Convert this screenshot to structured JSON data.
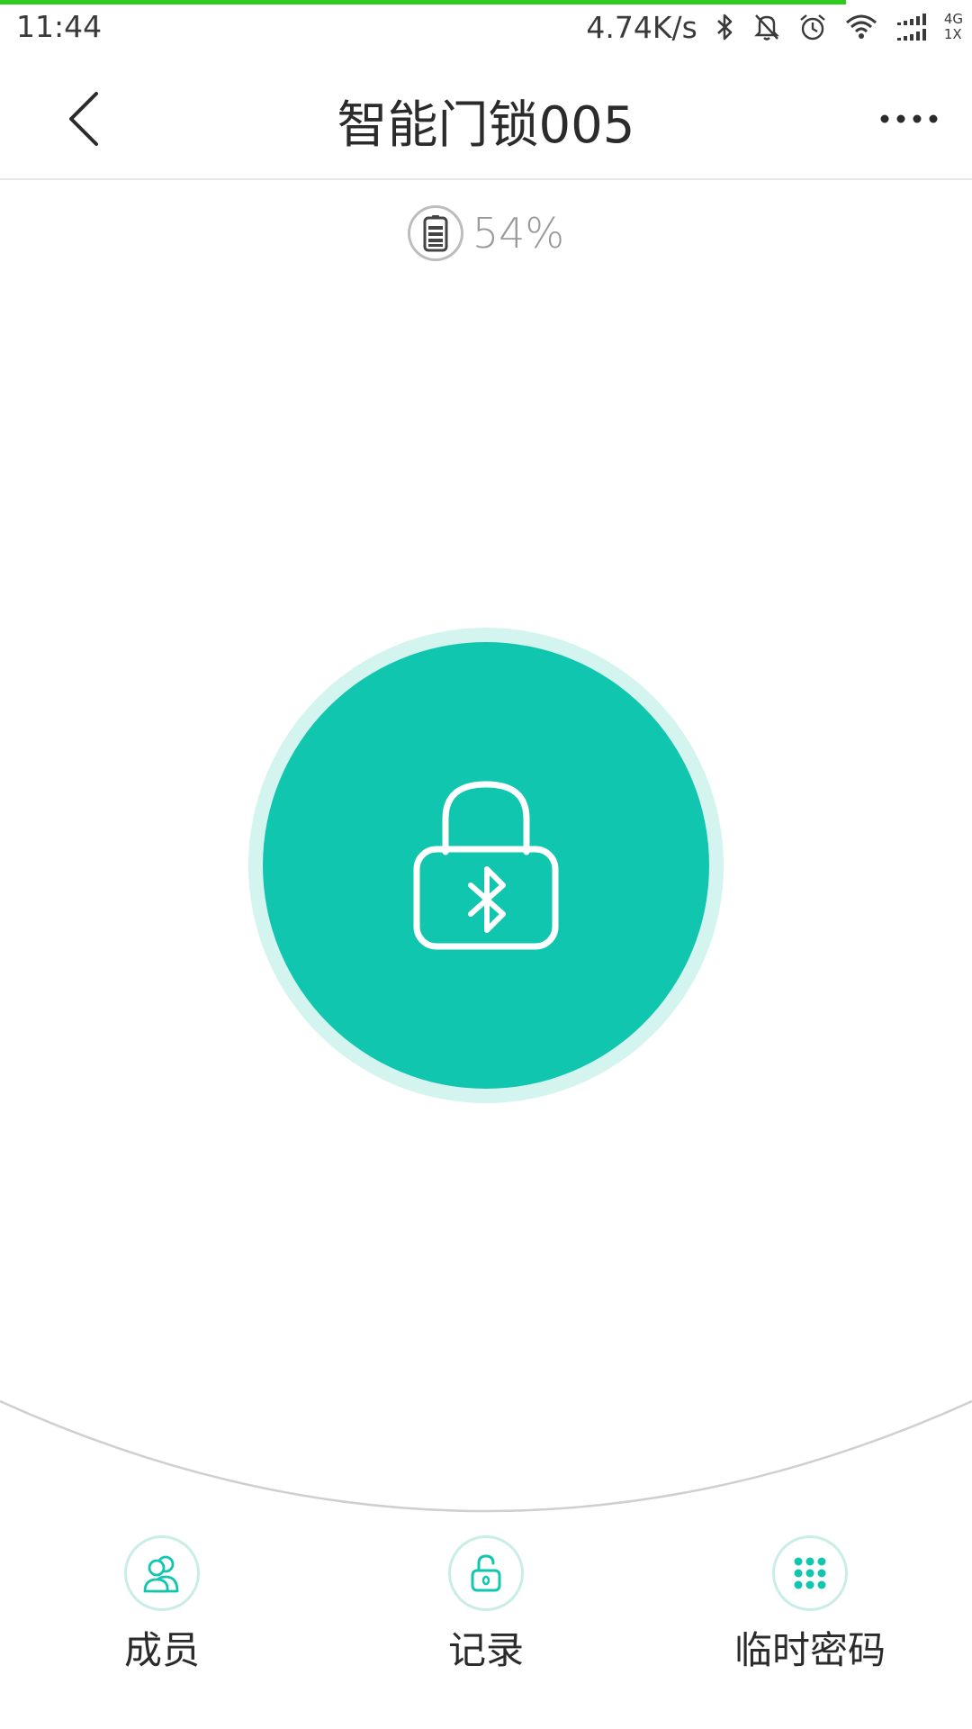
{
  "status_bar": {
    "time": "11:44",
    "net_speed": "4.74K/s",
    "icons": [
      "bluetooth-icon",
      "bell-off-icon",
      "alarm-icon",
      "wifi-icon",
      "signal-icon"
    ],
    "net_type_top": "4G",
    "net_type_bottom": "1X"
  },
  "header": {
    "title": "智能门锁005",
    "back_icon": "chevron-left-icon",
    "more_icon": "more-dots-icon"
  },
  "battery": {
    "text": "54%",
    "level": 54,
    "icon": "battery-icon"
  },
  "unlock": {
    "icon": "bluetooth-lock-icon",
    "color": "#11c6ae",
    "ring_color": "#d4f4ef"
  },
  "bottom_nav": [
    {
      "label": "成员",
      "icon": "members-icon"
    },
    {
      "label": "记录",
      "icon": "unlock-record-icon"
    },
    {
      "label": "临时密码",
      "icon": "keypad-icon"
    }
  ],
  "colors": {
    "accent": "#11c6ae",
    "progress": "#2ecc1f"
  }
}
